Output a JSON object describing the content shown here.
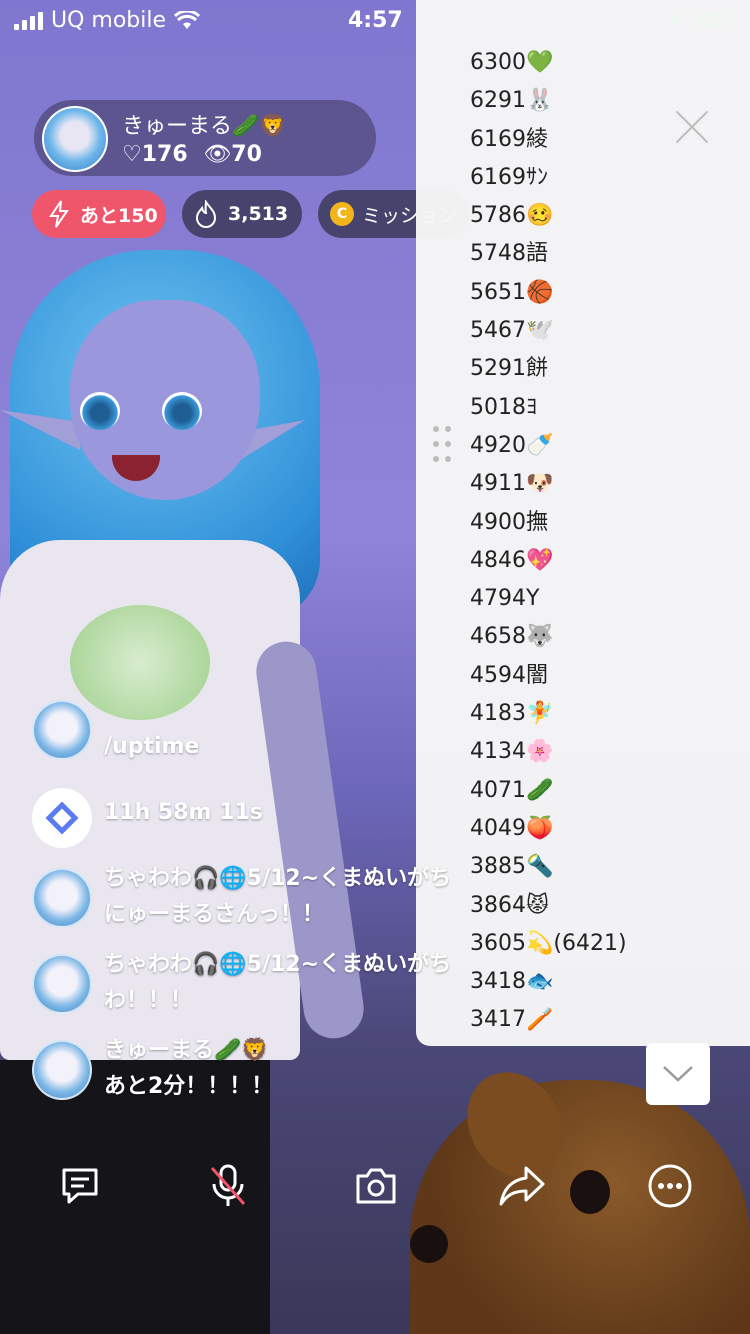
{
  "status_bar": {
    "carrier": "UQ mobile",
    "time": "4:57"
  },
  "host": {
    "name": "きゅーまる🥒🦁",
    "hearts": "♡176",
    "views": "70"
  },
  "pills": {
    "remaining": "あと150",
    "points": "3,513",
    "mission": "ミッション",
    "coin_letter": "C"
  },
  "ranking": [
    "6300💚",
    "6291🐰",
    "6169綾",
    "6169ｻﾝ",
    "5786🥴",
    "5748語",
    "5651🏀",
    "5467🕊️",
    "5291餅",
    "5018ﾖ",
    "4920🍼",
    "4911🐶",
    "4900撫",
    "4846💖",
    "4794Y",
    "4658🐺",
    "4594闇",
    "4183🧚",
    "4134🌸",
    "4071🥒",
    "4049🍑",
    "3885🔦",
    "3864😾",
    "3605💫(6421)",
    "3418🐟",
    "3417🪥"
  ],
  "chat": [
    {
      "line1": "/uptime",
      "line2": ""
    },
    {
      "line1": "11h 58m 11s",
      "line2": ""
    },
    {
      "line1": "ちゃわわ🎧🌐5/12~くまぬいがち",
      "line2": "にゅーまるさんっ！！"
    },
    {
      "line1": "ちゃわわ🎧🌐5/12~くまぬいがち",
      "line2": "わ！！！"
    },
    {
      "line1": "きゅーまる🥒🦁",
      "line2": "あと2分！！！！"
    }
  ],
  "toolbar_icons": [
    "comment-icon",
    "mic-muted-icon",
    "camera-icon",
    "share-icon",
    "more-icon"
  ],
  "colors": {
    "accent_red": "#f0566b",
    "battery_green": "#33c759"
  }
}
